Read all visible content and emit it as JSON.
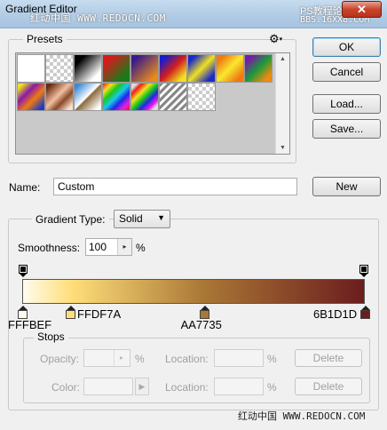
{
  "window": {
    "title": "Gradient Editor",
    "close_label": "✕"
  },
  "watermarks": {
    "top_left": "红动中国 WWW.REDOCN.COM",
    "top_right_1": "PS教程论坛",
    "top_right_2": "BBS.16XX8.COM",
    "bottom": "红动中国 WWW.REDOCN.COM"
  },
  "presets": {
    "legend": "Presets",
    "menu_icon": "gear-icon",
    "swatches": [
      {
        "name": "foreground-to-background"
      },
      {
        "name": "foreground-to-transparent"
      },
      {
        "name": "black-white"
      },
      {
        "name": "red-green"
      },
      {
        "name": "violet-orange"
      },
      {
        "name": "blue-red-yellow"
      },
      {
        "name": "blue-yellow-blue"
      },
      {
        "name": "orange-yellow-orange"
      },
      {
        "name": "violet-green-orange"
      },
      {
        "name": "yellow-violet-orange-blue"
      },
      {
        "name": "copper"
      },
      {
        "name": "chrome"
      },
      {
        "name": "spectrum"
      },
      {
        "name": "transparent-rainbow"
      },
      {
        "name": "transparent-stripes"
      },
      {
        "name": "neutral-density"
      }
    ]
  },
  "buttons": {
    "ok": "OK",
    "cancel": "Cancel",
    "load": "Load...",
    "save": "Save...",
    "new": "New"
  },
  "name_field": {
    "label": "Name:",
    "value": "Custom"
  },
  "gradient": {
    "type_label": "Gradient Type:",
    "type_value": "Solid",
    "smoothness_label": "Smoothness:",
    "smoothness_value": "100",
    "smoothness_unit": "%",
    "stops": [
      {
        "label": "FFFBEF",
        "color": "#FFFBEF",
        "location": 0
      },
      {
        "label": "FFDF7A",
        "color": "#FFDF7A",
        "location": 14
      },
      {
        "label": "AA7735",
        "color": "#AA7735",
        "location": 53
      },
      {
        "label": "6B1D1D",
        "color": "#6B1D1D",
        "location": 100
      }
    ]
  },
  "stops_group": {
    "legend": "Stops",
    "opacity_label": "Opacity:",
    "opacity_unit": "%",
    "color_label": "Color:",
    "location_label": "Location:",
    "location_unit": "%",
    "delete_label": "Delete"
  }
}
